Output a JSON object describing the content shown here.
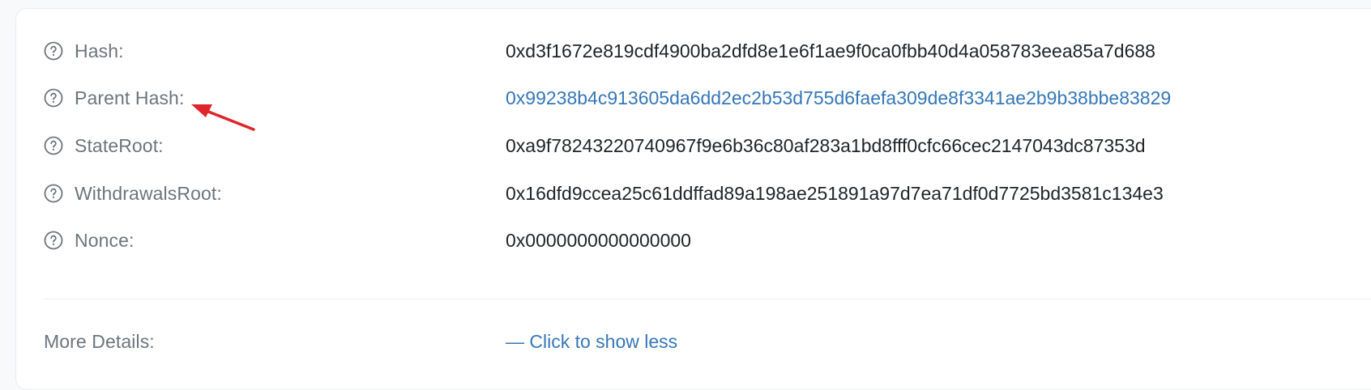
{
  "rows": [
    {
      "label": "Hash:",
      "value": "0xd3f1672e819cdf4900ba2dfd8e1e6f1ae9f0ca0fbb40d4a058783eea85a7d688",
      "is_link": false
    },
    {
      "label": "Parent Hash:",
      "value": "0x99238b4c913605da6dd2ec2b53d755d6faefa309de8f3341ae2b9b38bbe83829",
      "is_link": true
    },
    {
      "label": "StateRoot:",
      "value": "0xa9f78243220740967f9e6b36c80af283a1bd8fff0cfc66cec2147043dc87353d",
      "is_link": false
    },
    {
      "label": "WithdrawalsRoot:",
      "value": "0x16dfd9ccea25c61ddffad89a198ae251891a97d7ea71df0d7725bd3581c134e3",
      "is_link": false
    },
    {
      "label": "Nonce:",
      "value": "0x0000000000000000",
      "is_link": false
    }
  ],
  "more_details": {
    "label": "More Details:",
    "toggle_text": "— Click to show less"
  },
  "icons": {
    "help": "question-circle-icon",
    "annotation": "red-arrow-annotation"
  },
  "colors": {
    "label": "#6c757d",
    "value": "#212529",
    "link": "#3577b8",
    "annotation": "#e0242b"
  }
}
